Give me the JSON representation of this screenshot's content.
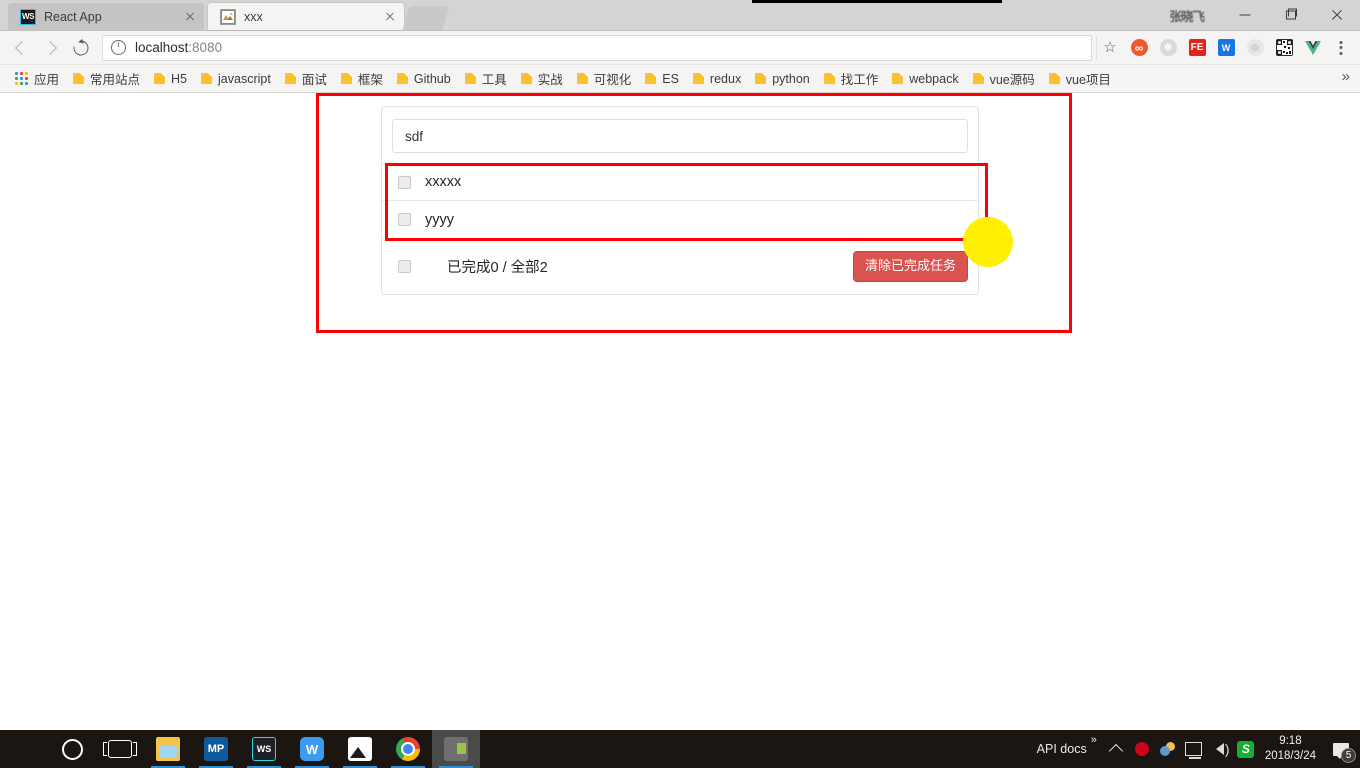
{
  "window": {
    "user_label": "张晓飞",
    "minimize_label": "—",
    "maximize_label": "❐",
    "close_label": "✕"
  },
  "browser": {
    "tabs": [
      {
        "title": "React App",
        "favicon": "webstorm-icon",
        "active": false
      },
      {
        "title": "xxx",
        "favicon": "broken-image-icon",
        "active": true
      }
    ],
    "new_tab_label": "",
    "toolbar": {
      "back_label": "",
      "forward_label": "",
      "reload_label": "",
      "url_main": "localhost",
      "url_port": ":8080",
      "star_label": "☆",
      "extensions": [
        {
          "name": "infinity-newtab-icon",
          "glyph": "∞",
          "class": "ext-infinity"
        },
        {
          "name": "react-devtools-icon",
          "glyph": "⚛",
          "class": "ext-react"
        },
        {
          "name": "fe-helper-icon",
          "glyph": "FE",
          "class": "ext-fe"
        },
        {
          "name": "wps-clip-icon",
          "glyph": "W",
          "class": "ext-w"
        },
        {
          "name": "target-circle-icon",
          "glyph": "◎",
          "class": "ext-circle"
        },
        {
          "name": "qr-code-icon",
          "glyph": "░",
          "class": "ext-qr"
        },
        {
          "name": "vue-devtools-icon",
          "glyph": "V",
          "class": "ext-vue"
        }
      ],
      "menu_label": ""
    },
    "bookmarks": {
      "apps_label": "应用",
      "items": [
        "常用站点",
        "H5",
        "javascript",
        "面试",
        "框架",
        "Github",
        "工具",
        "实战",
        "可视化",
        "ES",
        "redux",
        "python",
        "找工作",
        "webpack",
        "vue源码",
        "vue项目"
      ],
      "overflow_label": "»"
    }
  },
  "app": {
    "input": {
      "value": "sdf",
      "placeholder": ""
    },
    "todos": [
      {
        "text": "xxxxx",
        "done": false
      },
      {
        "text": "yyyy",
        "done": false
      }
    ],
    "footer": {
      "toggle_all_done": false,
      "count_text": "已完成0 / 全部2",
      "clear_button_label": "清除已完成任务"
    },
    "colors": {
      "clear_button_bg": "#d9534f",
      "annotation_red": "#ff0000",
      "highlight_yellow": "#ffef00"
    }
  },
  "taskbar": {
    "items": [
      {
        "name": "start-button",
        "icon": "windows-logo-icon"
      },
      {
        "name": "cortana-button",
        "icon": "cortana-circle-icon"
      },
      {
        "name": "task-view-button",
        "icon": "task-view-icon"
      },
      {
        "name": "file-explorer-button",
        "icon": "folder-icon"
      },
      {
        "name": "mp-app-button",
        "icon": "mp-icon"
      },
      {
        "name": "webstorm-button",
        "icon": "webstorm-icon"
      },
      {
        "name": "wps-button",
        "icon": "wps-writer-icon"
      },
      {
        "name": "photos-button",
        "icon": "picture-icon"
      },
      {
        "name": "chrome-button",
        "icon": "chrome-icon"
      },
      {
        "name": "snipaste-button",
        "icon": "snipaste-icon"
      }
    ],
    "tray": {
      "api_docs_label": "API docs",
      "overflow_label": "»",
      "caret_label": "",
      "sogou_label": "S",
      "time": "9:18",
      "date": "2018/3/24",
      "notification_count": "5"
    }
  }
}
